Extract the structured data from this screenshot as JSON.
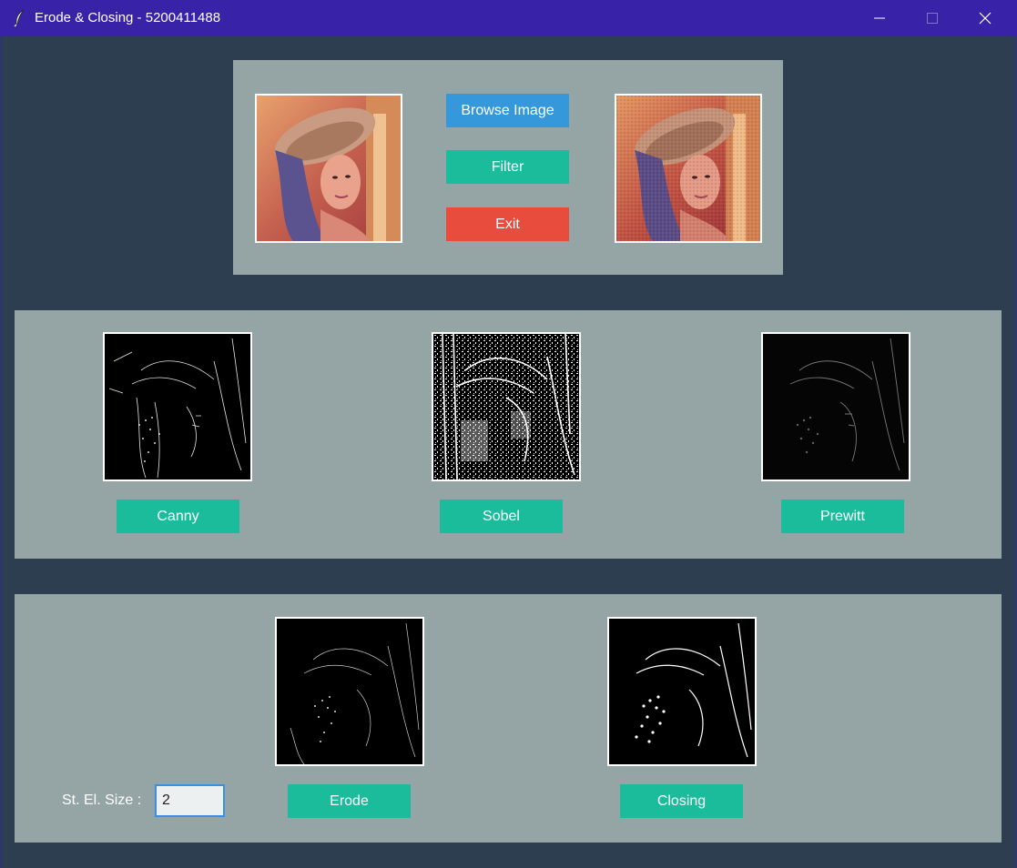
{
  "window": {
    "title": "Erode & Closing - 5200411488",
    "title_bar_color": "#3823a8",
    "icons": {
      "app": "feather-icon",
      "minimize": "minimize-icon",
      "maximize": "maximize-icon",
      "close": "close-icon"
    }
  },
  "colors": {
    "background": "#2c3e50",
    "panel": "#95a5a6",
    "teal_button": "#1abc9c",
    "blue_button": "#3498db",
    "red_button": "#e74c3c"
  },
  "top_panel": {
    "browse_label": "Browse Image",
    "filter_label": "Filter",
    "exit_label": "Exit",
    "original_image": "lena-color-photo",
    "filtered_image": "lena-filtered-photo"
  },
  "edge_panel": {
    "canny_label": "Canny",
    "sobel_label": "Sobel",
    "prewitt_label": "Prewitt",
    "canny_image": "canny-edge-result",
    "sobel_image": "sobel-edge-result",
    "prewitt_image": "prewitt-edge-result"
  },
  "morph_panel": {
    "size_label": "St. El. Size :",
    "size_value": "2",
    "erode_label": "Erode",
    "closing_label": "Closing",
    "erode_image": "erode-result",
    "closing_image": "closing-result"
  }
}
